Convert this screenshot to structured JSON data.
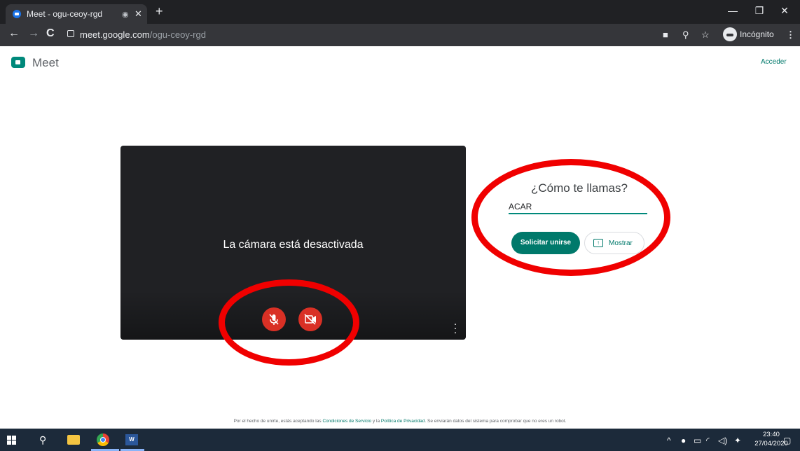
{
  "browser": {
    "tab_title": "Meet - ogu-ceoy-rgd",
    "url_domain": "meet.google.com",
    "url_path": "/ogu-ceoy-rgd",
    "profile_label": "Incógnito"
  },
  "page": {
    "app_name": "Meet",
    "signin_label": "Acceder",
    "camera_off_text": "La cámara está desactivada",
    "name_prompt": "¿Cómo te llamas?",
    "name_value": "ACAR",
    "join_button": "Solicitar unirse",
    "present_button": "Mostrar",
    "footer": {
      "pre": "Por el hecho de unirte, estás aceptando las ",
      "terms": "Condiciones de Servicio",
      "mid": " y la ",
      "privacy": "Política de Privacidad",
      "post": ". Se enviarán datos del sistema para comprobar que no eres un robot."
    }
  },
  "taskbar": {
    "time": "23:40",
    "date": "27/04/2020"
  },
  "annotations": {
    "ring_color": "#f00000"
  }
}
